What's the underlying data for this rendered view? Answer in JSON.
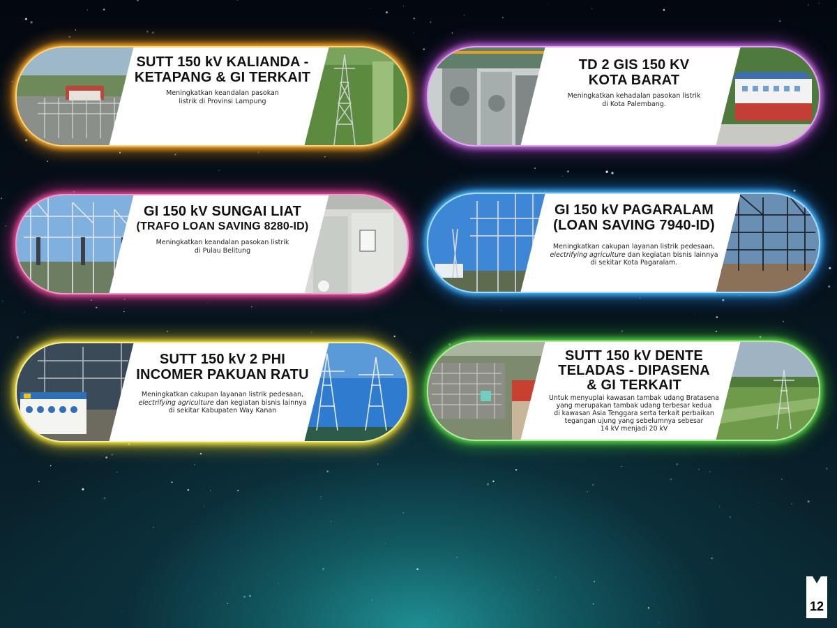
{
  "cards": [
    {
      "title_lines": [
        "SUTT 150 kV KALIANDA -",
        "KETAPANG & GI TERKAIT"
      ],
      "desc_lines": [
        "Meningkatkan keandalan pasokan",
        "listrik di Provinsi Lampung"
      ],
      "glow": "#ffb02e"
    },
    {
      "title_lines": [
        "TD 2 GIS 150 KV",
        "KOTA BARAT"
      ],
      "desc_lines": [
        "Meningkatkan kehadalan pasokan listrik",
        "di Kota Palembang."
      ],
      "glow": "#c06ad8"
    },
    {
      "title_lines": [
        "GI 150 kV SUNGAI LIAT",
        "(TRAFO LOAN SAVING 8280-ID)"
      ],
      "desc_lines": [
        "Meningkatkan keandalan pasokan listrik",
        "di Pulau Belitung"
      ],
      "glow": "#e0509a"
    },
    {
      "title_lines": [
        "GI 150 kV PAGARALAM",
        "(LOAN SAVING 7940-ID)"
      ],
      "desc_line1": "Meningkatkan cakupan layanan listrik pedesaan,",
      "desc_italic": "electrifying agriculture",
      "desc_line2_rest": " dan kegiatan bisnis lainnya",
      "desc_line3": "di sekitar Kota Pagaralam.",
      "glow": "#46b8ff"
    },
    {
      "title_lines": [
        "SUTT 150 kV 2 PHI",
        "INCOMER PAKUAN RATU"
      ],
      "desc_line1": "Meningkatkan cakupan layanan listrik pedesaan,",
      "desc_italic": "electrifying agriculture",
      "desc_line2_rest": " dan kegiatan bisnis lainnya",
      "desc_line3": "di sekitar Kabupaten Way Kanan",
      "glow": "#f0e040"
    },
    {
      "title_lines": [
        "SUTT 150 kV DENTE",
        "TELADAS - DIPASENA",
        "& GI TERKAIT"
      ],
      "desc_lines": [
        "Untuk menyuplai kawasan tambak udang Bratasena",
        "yang merupakan tambak udang terbesar kedua",
        "di kawasan Asia Tenggara serta terkait perbaikan",
        "tegangan ujung yang sebelumnya sebesar",
        "14 kV menjadi 20 kV"
      ],
      "glow": "#5fd04a"
    }
  ],
  "page_number": "12"
}
